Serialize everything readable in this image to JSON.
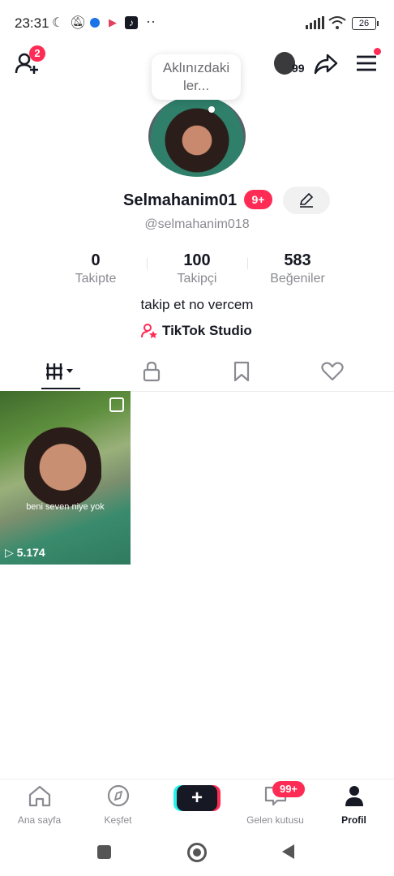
{
  "status_bar": {
    "time": "23:31",
    "battery": "26",
    "dots": "··"
  },
  "header": {
    "follow_requests_badge": "2",
    "coins_count": "99"
  },
  "tooltip": {
    "text": "Aklınızdaki ler..."
  },
  "profile": {
    "name": "Selmahanim01",
    "name_badge": "9+",
    "handle": "@selmahanim018",
    "stats": [
      {
        "value": "0",
        "label": "Takipte"
      },
      {
        "value": "100",
        "label": "Takipçi"
      },
      {
        "value": "583",
        "label": "Beğeniler"
      }
    ],
    "bio": "takip et no vercem",
    "studio_link": "TikTok Studio"
  },
  "tabs": [
    {
      "icon": "grid-icon",
      "selected": true
    },
    {
      "icon": "lock-icon",
      "selected": false
    },
    {
      "icon": "bookmark-icon",
      "selected": false
    },
    {
      "icon": "heart-icon",
      "selected": false
    }
  ],
  "videos": [
    {
      "caption": "beni seven niye yok",
      "views": "5.174"
    }
  ],
  "bottom_nav": {
    "home": "Ana sayfa",
    "discover": "Keşfet",
    "create": "+",
    "inbox": "Gelen kutusu",
    "inbox_badge": "99+",
    "profile": "Profil"
  },
  "colors": {
    "accent": "#fe2c55",
    "cyan": "#25f4ee",
    "text": "#161823",
    "muted": "#8a8b91"
  }
}
